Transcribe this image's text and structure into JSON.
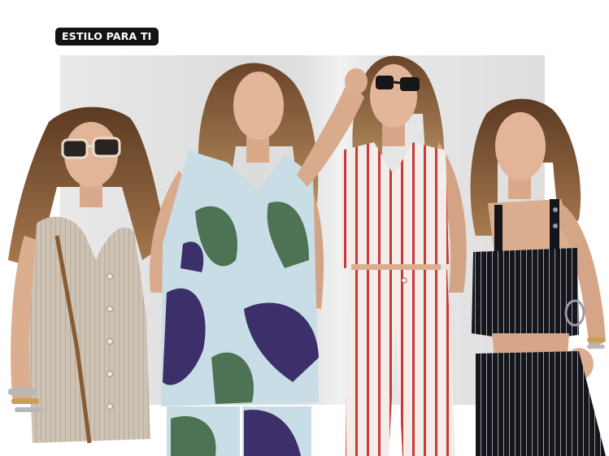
{
  "badge": {
    "label": "ESTILO PARA TI"
  },
  "colors": {
    "badge_bg": "#141414",
    "badge_text": "#ffffff",
    "backdrop": "#e2e2e2",
    "stripe_red": "#c93a3a",
    "navy_pinstripe": "#15151c",
    "linen": "#cdc2b3",
    "print_purple": "#3c2f6a",
    "print_green": "#4e7354",
    "print_ice_blue": "#c9dde6"
  },
  "figures": [
    {
      "name": "model-linen-vest"
    },
    {
      "name": "model-floral-print-set"
    },
    {
      "name": "model-red-striped-set"
    },
    {
      "name": "model-black-pinstripe-set"
    }
  ]
}
